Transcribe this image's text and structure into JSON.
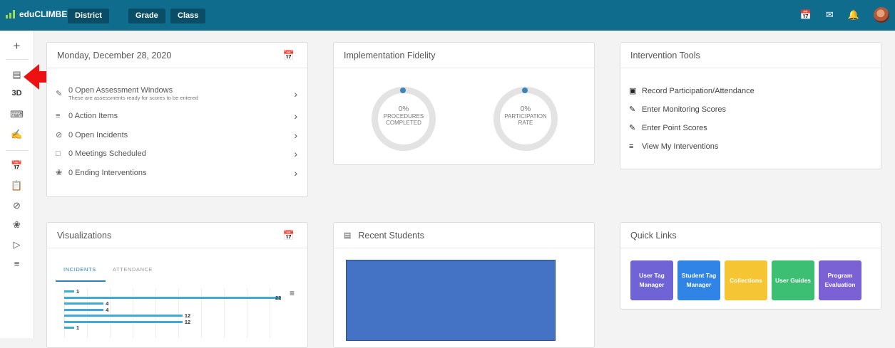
{
  "header": {
    "brand": "eduCLIMBER",
    "nav": [
      "District",
      "Grade",
      "Class"
    ],
    "icons": [
      "calendar-icon",
      "mail-icon",
      "bell-icon",
      "user-avatar"
    ]
  },
  "sidebar": {
    "icons": [
      "plus-icon",
      "id-card-icon",
      "3d-icon",
      "keyboard-icon",
      "hand-icon",
      "calendar-icon",
      "clipboard-icon",
      "tag-icon",
      "hands-icon",
      "send-icon",
      "list-icon"
    ],
    "threed_label": "3D"
  },
  "overview": {
    "date": "Monday, December 28, 2020",
    "items": [
      {
        "label": "0 Open Assessment Windows",
        "sub": "These are assessments ready for scores to be entered"
      },
      {
        "label": "0 Action Items",
        "sub": ""
      },
      {
        "label": "0 Open Incidents",
        "sub": ""
      },
      {
        "label": "0 Meetings Scheduled",
        "sub": ""
      },
      {
        "label": "0 Ending Interventions",
        "sub": ""
      }
    ]
  },
  "fidelity": {
    "title": "Implementation Fidelity",
    "gauges": [
      {
        "value": "0%",
        "line1": "PROCEDURES",
        "line2": "COMPLETED"
      },
      {
        "value": "0%",
        "line1": "PARTICIPATION",
        "line2": "RATE"
      }
    ]
  },
  "tools": {
    "title": "Intervention Tools",
    "items": [
      "Record Participation/Attendance",
      "Enter Monitoring Scores",
      "Enter Point Scores",
      "View My Interventions"
    ]
  },
  "visualizations": {
    "title": "Visualizations",
    "tabs": [
      "INCIDENTS",
      "ATTENDANCE"
    ],
    "active_tab": "INCIDENTS"
  },
  "chart_data": {
    "type": "bar",
    "orientation": "horizontal",
    "values": [
      1,
      22,
      4,
      4,
      12,
      12,
      1
    ],
    "xlim": [
      0,
      22
    ],
    "color": "#3fa9d8"
  },
  "recent": {
    "title": "Recent Students"
  },
  "quicklinks": {
    "title": "Quick Links",
    "items": [
      {
        "label": "User Tag Manager",
        "color": "#6f63d6"
      },
      {
        "label": "Student Tag Manager",
        "color": "#2f84e6"
      },
      {
        "label": "Collections",
        "color": "#f5c533"
      },
      {
        "label": "User Guides",
        "color": "#3cbf73"
      },
      {
        "label": "Program Evaluation",
        "color": "#7b62d4"
      }
    ]
  },
  "colors": {
    "topbar": "#0f6c8d",
    "nav_button": "#0a4d66",
    "accent_arrow": "#ee1111",
    "recent_panel": "#4472c4"
  }
}
